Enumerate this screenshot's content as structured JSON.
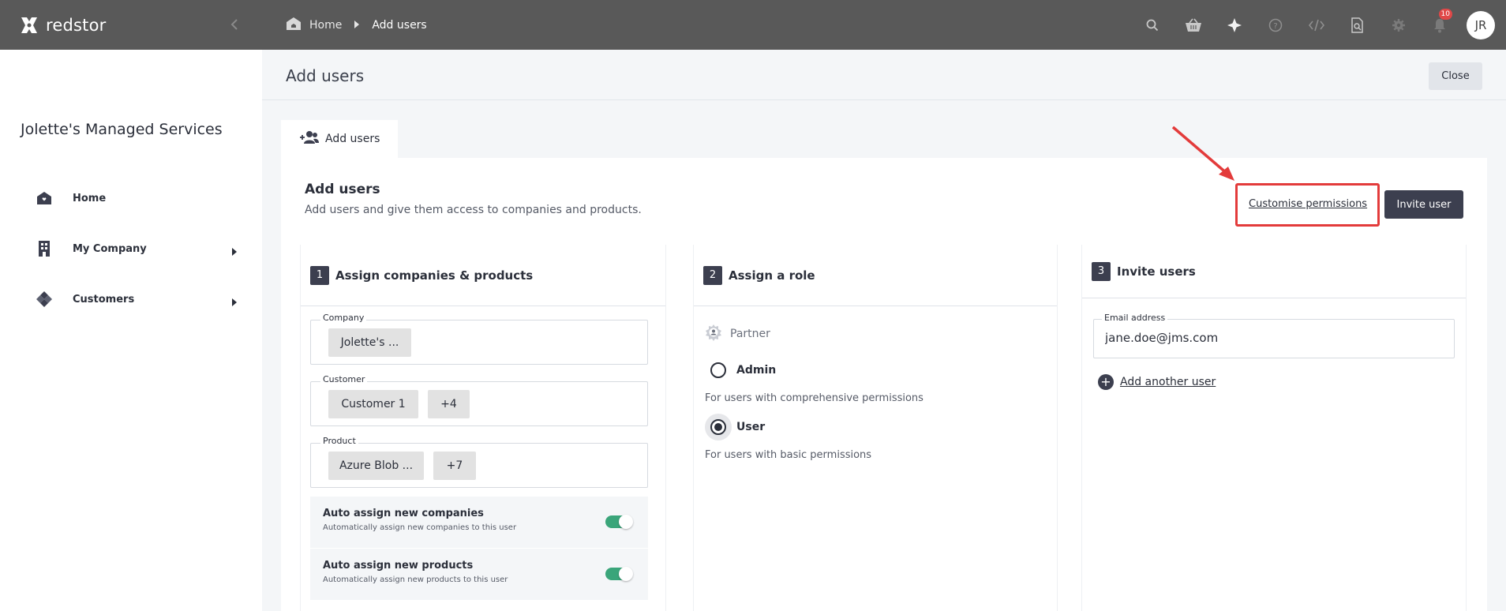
{
  "brand": {
    "name": "redstor"
  },
  "breadcrumb": {
    "home": "Home",
    "current": "Add users"
  },
  "notifications": {
    "count": "10"
  },
  "user": {
    "initials": "JR"
  },
  "sidebar": {
    "company": "Jolette's Managed Services",
    "items": [
      {
        "label": "Home",
        "icon": "home-icon"
      },
      {
        "label": "My Company",
        "icon": "building-icon"
      },
      {
        "label": "Customers",
        "icon": "customers-icon"
      }
    ]
  },
  "page": {
    "title": "Add users",
    "close_label": "Close"
  },
  "tab": {
    "label": "Add users"
  },
  "card": {
    "title": "Add users",
    "subtitle": "Add users and give them access to companies and products.",
    "customise_label": "Customise permissions",
    "invite_label": "Invite user"
  },
  "step1": {
    "num": "1",
    "title": "Assign companies & products",
    "company": {
      "label": "Company",
      "chips": [
        "Jolette's ..."
      ]
    },
    "customer": {
      "label": "Customer",
      "chips": [
        "Customer 1",
        "+4"
      ]
    },
    "product": {
      "label": "Product",
      "chips": [
        "Azure Blob ...",
        "+7"
      ]
    },
    "auto_companies": {
      "title": "Auto assign new companies",
      "desc": "Automatically assign new companies to this user"
    },
    "auto_products": {
      "title": "Auto assign new products",
      "desc": "Automatically assign new products to this user"
    }
  },
  "step2": {
    "num": "2",
    "title": "Assign a role",
    "group": "Partner",
    "admin": {
      "label": "Admin",
      "desc": "For users with comprehensive permissions"
    },
    "user": {
      "label": "User",
      "desc": "For users with basic permissions"
    }
  },
  "step3": {
    "num": "3",
    "title": "Invite users",
    "email_label": "Email address",
    "email_value": "jane.doe@jms.com",
    "add_another": "Add another user"
  },
  "colors": {
    "topbar": "#595959",
    "primary": "#3c3f4f",
    "toggle_on": "#3aa57a",
    "highlight": "#e33b3b",
    "badge": "#e04848"
  }
}
